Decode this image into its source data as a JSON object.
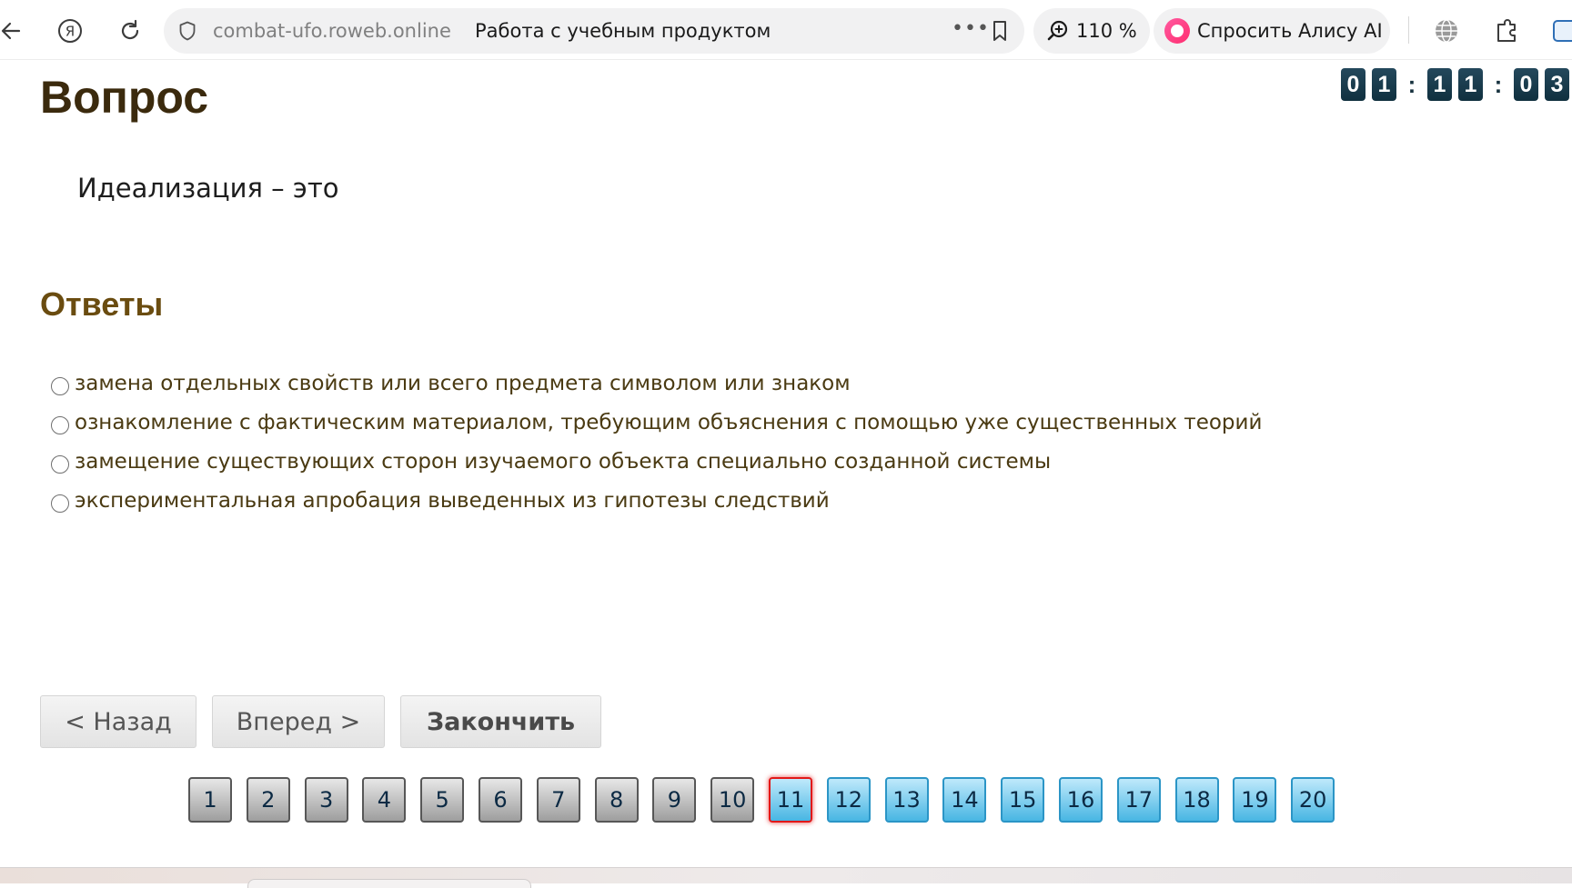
{
  "browser": {
    "url_host": "combat-ufo.roweb.online",
    "tab_title": "Работа с учебным продуктом",
    "zoom": "110 %",
    "alice_label": "Спросить Алису AI"
  },
  "page": {
    "heading": "Вопрос",
    "timer": [
      "0",
      "1",
      ":",
      "1",
      "1",
      ":",
      "0",
      "3"
    ],
    "question": "Идеализация – это",
    "answers_heading": "Ответы",
    "answers": [
      {
        "text": "замена отдельных свойств или всего предмета символом или знаком",
        "selected": false
      },
      {
        "text": "ознакомление с фактическим материалом, требующим объяснения с помощью уже существенных теорий",
        "selected": false
      },
      {
        "text": "замещение существующих сторон изучаемого объекта специально созданной системы",
        "selected": false
      },
      {
        "text": "экспериментальная апробация выведенных из гипотезы следствий",
        "selected": false
      }
    ],
    "buttons": {
      "back": "< Назад",
      "forward": "Вперед >",
      "finish": "Закончить"
    },
    "pagination": {
      "current": 11,
      "pages": [
        "1",
        "2",
        "3",
        "4",
        "5",
        "6",
        "7",
        "8",
        "9",
        "10",
        "11",
        "12",
        "13",
        "14",
        "15",
        "16",
        "17",
        "18",
        "19",
        "20"
      ]
    }
  },
  "colors": {
    "heading": "#3b2a0d",
    "answers_heading": "#6a4c10",
    "answered_page": "#9e9e9e",
    "unanswered_page": "#48b6e3",
    "current_page_border": "#e21818",
    "timer_digit": "#1a3c4e"
  },
  "icons": {
    "back": "arrow-left-icon",
    "yandex": "yandex-logo-icon",
    "reload": "reload-icon",
    "site_security": "shield-icon",
    "menu": "more-dots-icon",
    "bookmark": "bookmark-icon",
    "zoom": "zoom-icon",
    "alice": "alice-icon",
    "translate": "globe-icon",
    "extensions": "extension-icon"
  }
}
